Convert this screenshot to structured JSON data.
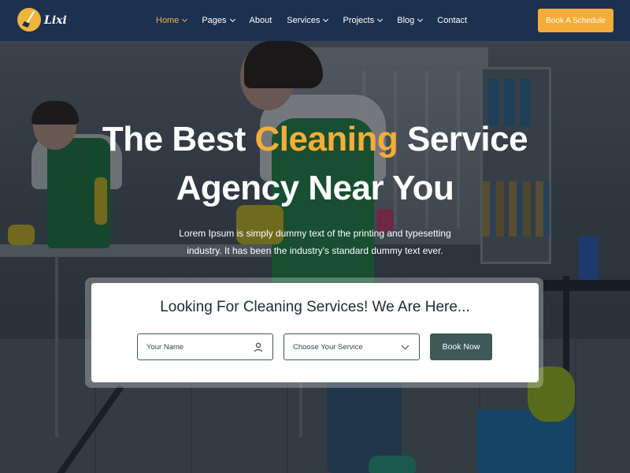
{
  "header": {
    "logo_text": "Lixi",
    "nav": [
      {
        "label": "Home",
        "active": true,
        "dropdown": true
      },
      {
        "label": "Pages",
        "active": false,
        "dropdown": true
      },
      {
        "label": "About",
        "active": false,
        "dropdown": false
      },
      {
        "label": "Services",
        "active": false,
        "dropdown": true
      },
      {
        "label": "Projects",
        "active": false,
        "dropdown": true
      },
      {
        "label": "Blog",
        "active": false,
        "dropdown": true
      },
      {
        "label": "Contact",
        "active": false,
        "dropdown": false
      }
    ],
    "cta_label": "Book A Schedule"
  },
  "hero": {
    "title_part1": "The Best ",
    "title_accent": "Cleaning",
    "title_part2": " Service",
    "title_line2": "Agency Near You",
    "description_line1": "Lorem Ipsum is simply dummy text of the printing and typesetting",
    "description_line2": "industry. It has been the industry's standard dummy text ever."
  },
  "search": {
    "title": "Looking For Cleaning Services! We Are Here...",
    "name_placeholder": "Your Name",
    "service_placeholder": "Choose Your Service",
    "button_label": "Book Now"
  },
  "colors": {
    "header_bg": "#1c3050",
    "accent": "#f4ad38",
    "button_teal": "#3d5a59"
  },
  "icons": {
    "logo": "broom-icon",
    "name_field": "user-icon",
    "service_field": "chevron-down-icon"
  }
}
